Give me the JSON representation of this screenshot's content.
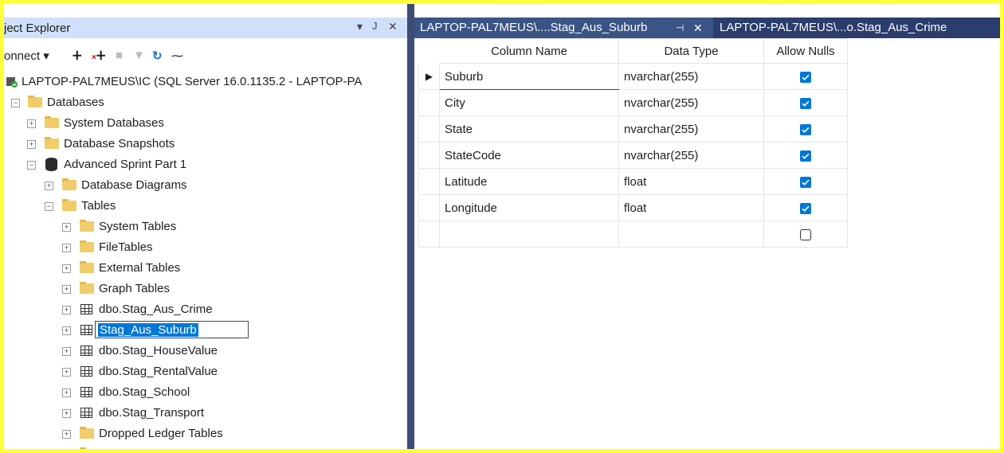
{
  "object_explorer": {
    "title": "ject Explorer",
    "controls": {
      "dropdown": "▾",
      "pin": "ᵃ",
      "close": "✕"
    },
    "toolbar": {
      "connect": "onnect ▾"
    },
    "tree": {
      "server": "LAPTOP-PAL7MEUS\\IC (SQL Server 16.0.1135.2 - LAPTOP-PA",
      "databases": "Databases",
      "system_databases": "System Databases",
      "database_snapshots": "Database Snapshots",
      "advanced_sprint": "Advanced Sprint Part 1",
      "database_diagrams": "Database Diagrams",
      "tables": "Tables",
      "system_tables": "System Tables",
      "filetables": "FileTables",
      "external_tables": "External Tables",
      "graph_tables": "Graph Tables",
      "table_items": [
        "dbo.Stag_Aus_Crime",
        "Stag_Aus_Suburb",
        "dbo.Stag_HouseValue",
        "dbo.Stag_RentalValue",
        "dbo.Stag_School",
        "dbo.Stag_Transport"
      ],
      "dropped_ledger": "Dropped Ledger Tables"
    }
  },
  "tabs": [
    {
      "label": "LAPTOP-PAL7MEUS\\....Stag_Aus_Suburb",
      "pin": "⊣",
      "close": "✕"
    },
    {
      "label": "LAPTOP-PAL7MEUS\\...o.Stag_Aus_Crime"
    }
  ],
  "grid": {
    "headers": [
      "Column Name",
      "Data Type",
      "Allow Nulls"
    ],
    "rows": [
      {
        "name": "Suburb",
        "type": "nvarchar(255)",
        "allow_nulls": true
      },
      {
        "name": "City",
        "type": "nvarchar(255)",
        "allow_nulls": true
      },
      {
        "name": "State",
        "type": "nvarchar(255)",
        "allow_nulls": true
      },
      {
        "name": "StateCode",
        "type": "nvarchar(255)",
        "allow_nulls": true
      },
      {
        "name": "Latitude",
        "type": "float",
        "allow_nulls": true
      },
      {
        "name": "Longitude",
        "type": "float",
        "allow_nulls": true
      },
      {
        "name": "",
        "type": "",
        "allow_nulls": false
      }
    ],
    "current_row_marker": "▶"
  },
  "colors": {
    "accent": "#0078d7",
    "tab_bar": "#2a3d6c",
    "active_tab": "#3b5486",
    "panel_title": "#cfe0f8",
    "folder": "#f0cc6a",
    "frame": "#ffff3a"
  }
}
